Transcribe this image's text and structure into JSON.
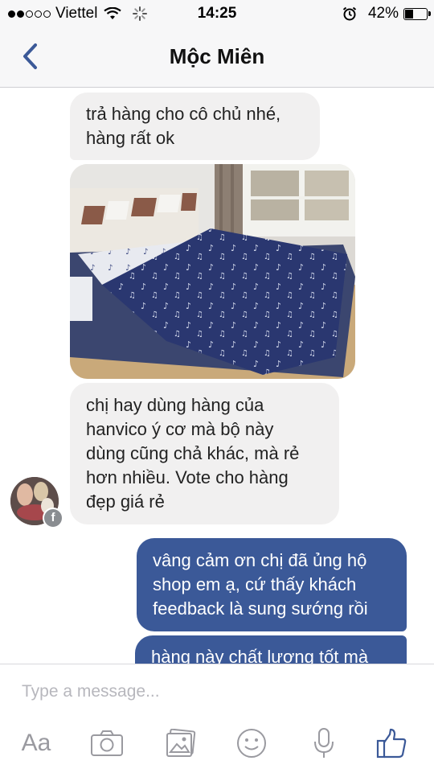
{
  "status_bar": {
    "carrier": "Viettel",
    "time": "14:25",
    "battery": "42%",
    "battery_level": 0.42
  },
  "header": {
    "title": "Mộc Miên",
    "back_icon": "chevron-left-icon"
  },
  "messages": [
    {
      "side": "incoming",
      "lines": [
        "trả hàng cho cô chủ nhé,",
        "hàng rất ok"
      ]
    },
    {
      "side": "incoming",
      "type": "photo",
      "description_icon": "bed-photo"
    },
    {
      "side": "incoming",
      "lines": [
        "chị hay dùng hàng của",
        "hanvico ý cơ mà bộ này",
        "dùng cũng chả khác, mà rẻ",
        "hơn nhiều. Vote cho hàng",
        "đẹp giá rẻ"
      ]
    },
    {
      "side": "outgoing",
      "lines": [
        "vâng cảm ơn chị đã ủng hộ",
        "shop em ạ, cứ thấy khách",
        "feedback là sung sướng rồi"
      ]
    },
    {
      "side": "outgoing",
      "lines": [
        "hàng này chất lượng tốt mà"
      ]
    }
  ],
  "composer": {
    "placeholder": "Type a message...",
    "aa_label": "Aa",
    "icons": [
      "aa-icon",
      "camera-icon",
      "gallery-icon",
      "emoji-icon",
      "microphone-icon",
      "like-icon"
    ]
  },
  "colors": {
    "accent": "#3b5998",
    "incoming_bubble": "#f1f0f0",
    "outgoing_bubble": "#3b5998",
    "icon_gray": "#9a9aa0"
  }
}
